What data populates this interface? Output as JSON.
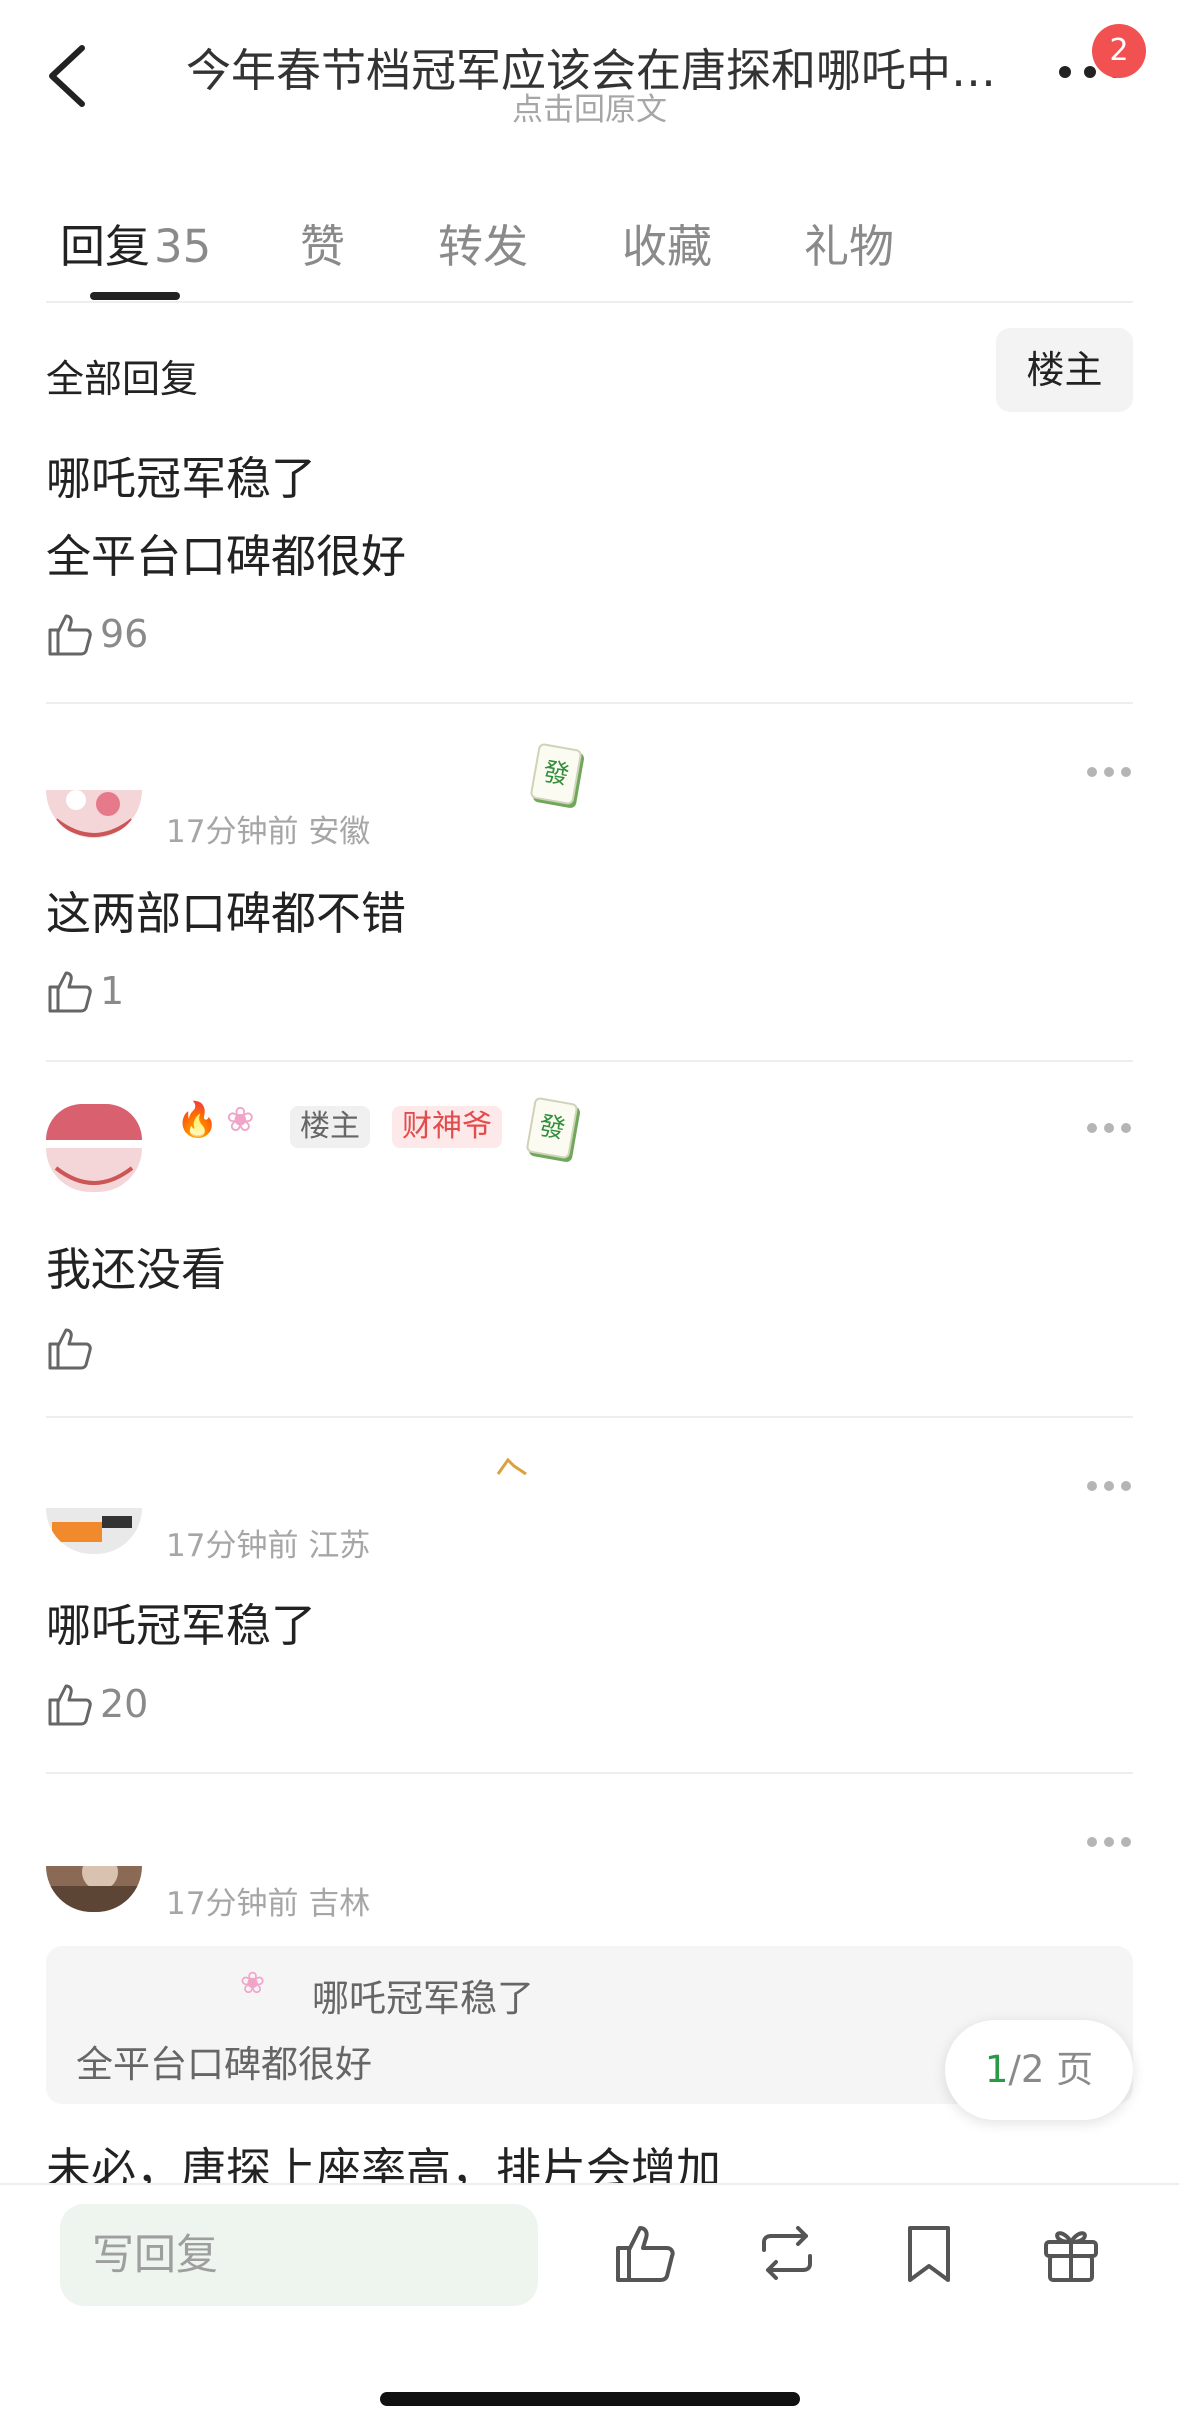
{
  "header": {
    "title": "今年春节档冠军应该会在唐探和哪吒中…",
    "subtitle": "点击回原文",
    "notification_count": "2"
  },
  "tabs": [
    {
      "label": "回复",
      "count": "35",
      "active": true
    },
    {
      "label": "赞"
    },
    {
      "label": "转发"
    },
    {
      "label": "收藏"
    },
    {
      "label": "礼物"
    }
  ],
  "filter": {
    "all_label": "全部回复",
    "op_label": "楼主"
  },
  "post": {
    "lines": [
      "哪吒冠军稳了",
      "全平台口碑都很好"
    ],
    "likes": "96"
  },
  "comments": [
    {
      "time": "17分钟前",
      "location": "安徽",
      "text": "这两部口碑都不错",
      "likes": "1",
      "badge_tile": "發"
    },
    {
      "op_tag": "楼主",
      "title_tag": "财神爷",
      "text": "我还没看",
      "likes": "",
      "badge_tile": "發"
    },
    {
      "time": "17分钟前",
      "location": "江苏",
      "text": "哪吒冠军稳了",
      "likes": "20"
    },
    {
      "time": "17分钟前",
      "location": "吉林",
      "quote_user": "哪吒冠军稳了",
      "quote_text": "全平台口碑都很好",
      "text": "未必，唐探上座率高，排片会增加"
    }
  ],
  "pager": {
    "current": "1",
    "total": "/2 页"
  },
  "bottom_bar": {
    "reply_placeholder": "写回复"
  },
  "colors": {
    "accent_green": "#2b9a48",
    "badge_red": "#f25151",
    "tile_green": "#2f8f3a"
  }
}
